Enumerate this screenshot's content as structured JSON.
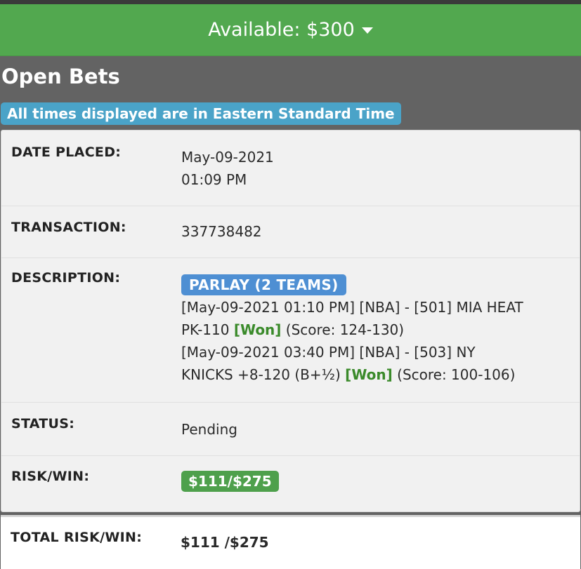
{
  "header": {
    "available_label": "Available: $300"
  },
  "page": {
    "title": "Open Bets",
    "timezone_note": "All times displayed are in Eastern Standard Time"
  },
  "bet": {
    "date_label": "DATE PLACED:",
    "date": "May-09-2021",
    "time": "01:09 PM",
    "transaction_label": "TRANSACTION:",
    "transaction": "337738482",
    "description_label": "DESCRIPTION:",
    "bet_type": "PARLAY (2 TEAMS)",
    "legs": [
      {
        "text_line1": "[May-09-2021 01:10 PM] [NBA] - [501] MIA HEAT",
        "text_line2_prefix": "PK-110",
        "result": "[Won]",
        "score": "(Score: 124-130)"
      },
      {
        "text_line1": "[May-09-2021 03:40 PM] [NBA] - [503] NY",
        "text_line2_prefix": "KNICKS +8-120 (B+½)",
        "result": "[Won]",
        "score": "(Score: 100-106)"
      }
    ],
    "status_label": "STATUS:",
    "status": "Pending",
    "risk_win_label": "RISK/WIN:",
    "risk_win": "$111/$275"
  },
  "totals": {
    "label": "TOTAL RISK/WIN:",
    "value": "$111 /$275"
  },
  "colors": {
    "available_bar": "#52a84f",
    "timezone_badge": "#4aa3c8",
    "parlay_badge": "#4e8fd3",
    "risk_badge": "#4ea04c",
    "won_text": "#3a8a2a"
  }
}
